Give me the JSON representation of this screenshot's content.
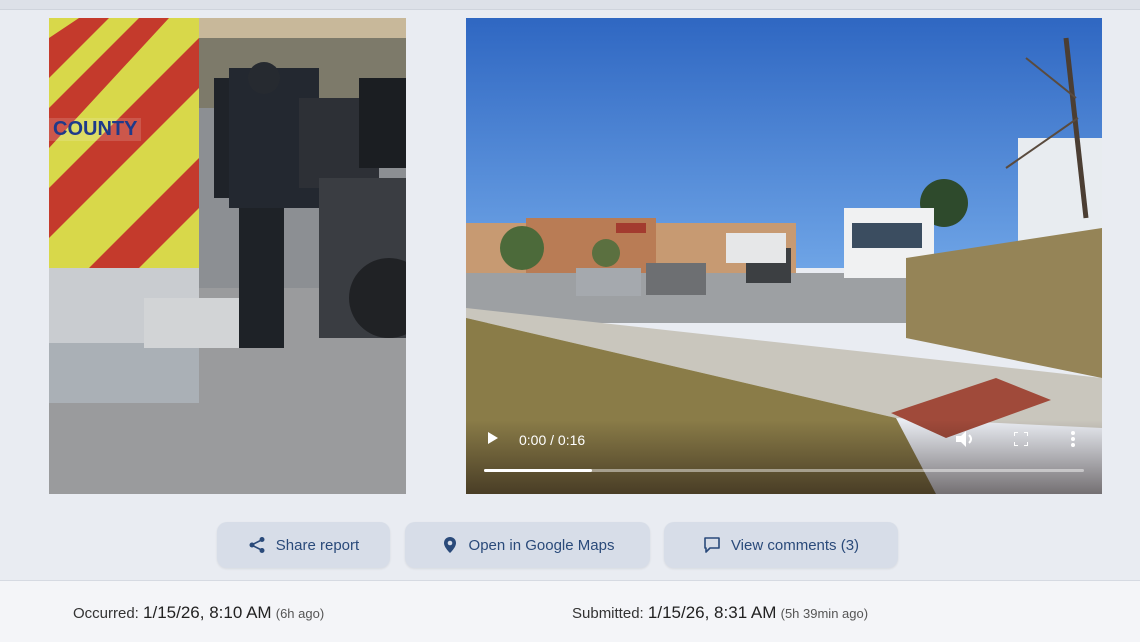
{
  "video": {
    "timecode": "0:00 / 0:16",
    "progress": 0.18,
    "controls": {
      "play_icon": "play-icon",
      "volume_icon": "volume-icon",
      "fullscreen_icon": "fullscreen-icon",
      "more_icon": "more-vertical-icon"
    }
  },
  "photo": {
    "vehicle_text": "COUNTY"
  },
  "actions": {
    "share": {
      "label": "Share report",
      "icon": "share-icon"
    },
    "maps": {
      "label": "Open in Google Maps",
      "icon": "map-pin-icon"
    },
    "comments": {
      "label": "View comments (3)",
      "icon": "comment-icon"
    }
  },
  "footer": {
    "occurred": {
      "label": "Occurred:",
      "value": "1/15/26, 8:10 AM",
      "ago": "(6h ago)"
    },
    "submitted": {
      "label": "Submitted:",
      "value": "1/15/26, 8:31 AM",
      "ago": "(5h 39min ago)"
    }
  },
  "colors": {
    "accent": "#2a4a7a",
    "button_bg": "#d7dde8",
    "page_bg": "#e9ecf2"
  }
}
